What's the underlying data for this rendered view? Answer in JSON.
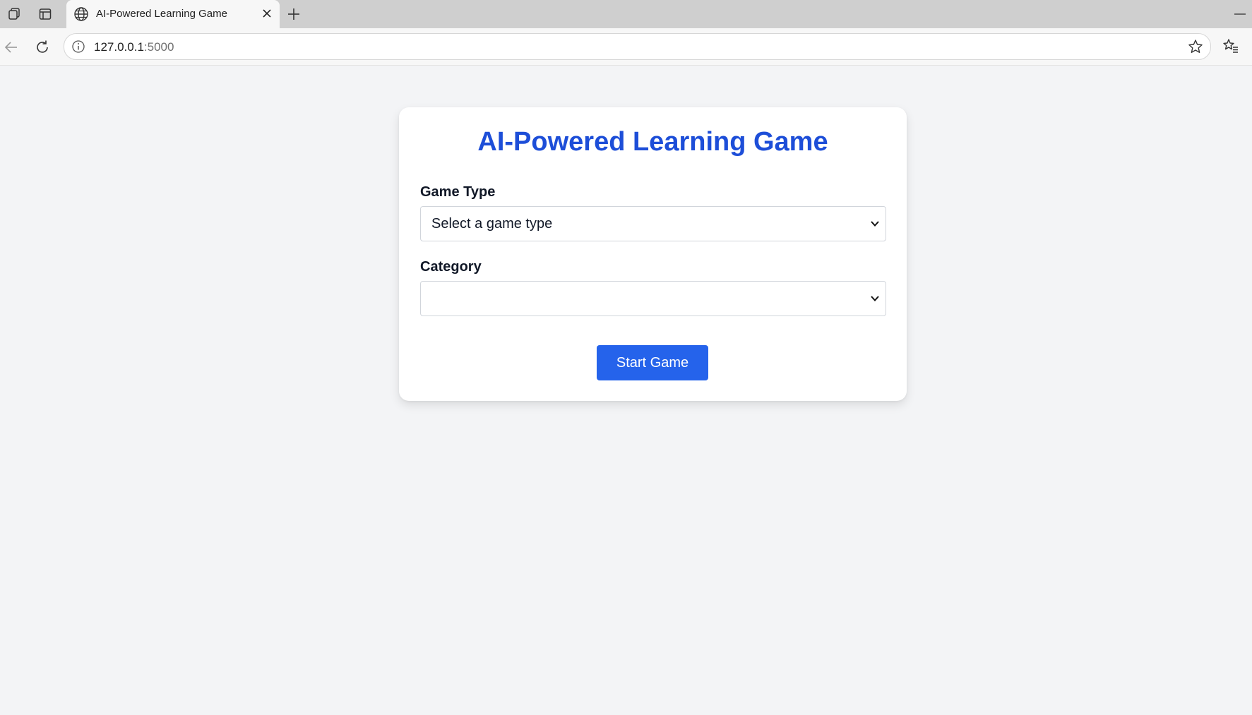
{
  "browser": {
    "tab_title": "AI-Powered Learning Game",
    "url_host": "127.0.0.1",
    "url_port": ":5000"
  },
  "page": {
    "title": "AI-Powered Learning Game",
    "game_type_label": "Game Type",
    "game_type_value": "Select a game type",
    "category_label": "Category",
    "category_value": "",
    "start_button": "Start Game"
  },
  "colors": {
    "title": "#1d4ed8",
    "button": "#2563eb",
    "background": "#f3f4f6"
  },
  "icons": [
    "workspaces-icon",
    "tab-actions-icon",
    "globe-icon",
    "close-icon",
    "plus-icon",
    "minimize-icon",
    "back-icon",
    "reload-icon",
    "info-icon",
    "star-icon",
    "favorites-icon",
    "chevron-down-icon"
  ]
}
